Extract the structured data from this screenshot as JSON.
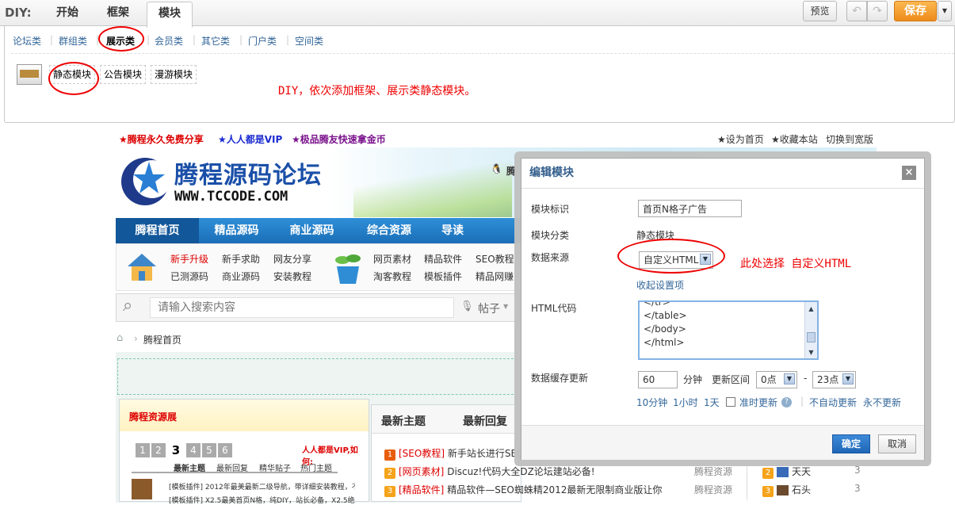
{
  "diy": {
    "logo": "DIY:",
    "tabs": [
      "开始",
      "框架",
      "模块"
    ],
    "preview_label": "预览",
    "undo_icon": "undo-icon",
    "redo_icon": "redo-icon",
    "save_label": "保存",
    "categories": [
      "论坛类",
      "群组类",
      "展示类",
      "会员类",
      "其它类",
      "门户类",
      "空间类"
    ],
    "modules": [
      "静态模块",
      "公告模块",
      "漫游模块"
    ],
    "note": "DIY，依次添加框架、展示类静态模块。"
  },
  "site": {
    "promos": [
      "★腾程永久免费分享",
      "★人人都是VIP",
      "★极品腾友快速拿金币"
    ],
    "toplinks": [
      "★设为首页",
      "★收藏本站",
      "切换到宽版"
    ],
    "logo_cn": "腾程源码论坛",
    "logo_url": "WWW.TCCODE.COM",
    "qq_text": "腾",
    "nav": [
      "腾程首页",
      "精品源码",
      "商业源码",
      "综合资源",
      "导读"
    ],
    "subnav_col1": [
      "新手升级",
      "已测源码"
    ],
    "subnav_col2": [
      "新手求助",
      "商业源码"
    ],
    "subnav_col3": [
      "网友分享",
      "安装教程"
    ],
    "subnav_col4": [
      "网页素材",
      "淘客教程"
    ],
    "subnav_col5": [
      "精品软件",
      "模板插件"
    ],
    "subnav_col6": [
      "SEO教程",
      "精品网赚"
    ],
    "search_placeholder": "请输入搜索内容",
    "search_type": "帖子",
    "breadcrumb": "腾程首页",
    "left_box_title": "腾程资源展",
    "pager": [
      "1",
      "2",
      "3",
      "4",
      "5",
      "6"
    ],
    "vip_note": "人人都是VIP,如何:",
    "mini_tabs": [
      "最新主题",
      "最新回复",
      "精华贴子",
      "热门主题"
    ],
    "mini_rows": [
      "[模板插件] 2012年最美最新二级导航，带详细安装教程，不",
      "[模板插件] X2.5最美首页N格，纯DIY，站长必备，X2.5绝对"
    ],
    "main_tabs": [
      "最新主题",
      "最新回复"
    ],
    "threads": [
      {
        "n": "1",
        "tag": "[SEO教程]",
        "title": "新手站长进行SEO",
        "cat": ""
      },
      {
        "n": "2",
        "tag": "[网页素材]",
        "title": "Discuz!代码大全DZ论坛建站必备!",
        "cat": "腾程资源"
      },
      {
        "n": "3",
        "tag": "[精品软件]",
        "title": "精品软件—SEO蜘蛛精2012最新无限制商业版让你",
        "cat": "腾程资源"
      }
    ],
    "side_rows": [
      {
        "n": "2",
        "name": "天天",
        "count": "3"
      },
      {
        "n": "3",
        "name": "石头",
        "count": "3"
      }
    ]
  },
  "modal": {
    "title": "编辑模块",
    "close_icon": "close-icon",
    "labels": {
      "id": "模块标识",
      "category": "模块分类",
      "source": "数据来源",
      "html": "HTML代码",
      "cache": "数据缓存更新"
    },
    "id_value": "首页N格子广告",
    "category_value": "静态模块",
    "source_value": "自定义HTML",
    "collapse_link": "收起设置项",
    "html_lines": [
      "</tr>",
      "</table>",
      "</body>",
      "</html>"
    ],
    "cache_minutes": "60",
    "minutes_unit": "分钟",
    "interval_label": "更新区间",
    "from_hour": "0点",
    "dash": "-",
    "to_hour": "23点",
    "quick_links": [
      "10分钟",
      "1小时",
      "1天"
    ],
    "timed_label": "准时更新",
    "no_auto": "不自动更新",
    "never": "永不更新",
    "ok_label": "确定",
    "cancel_label": "取消",
    "annotation": "此处选择 自定义HTML"
  }
}
